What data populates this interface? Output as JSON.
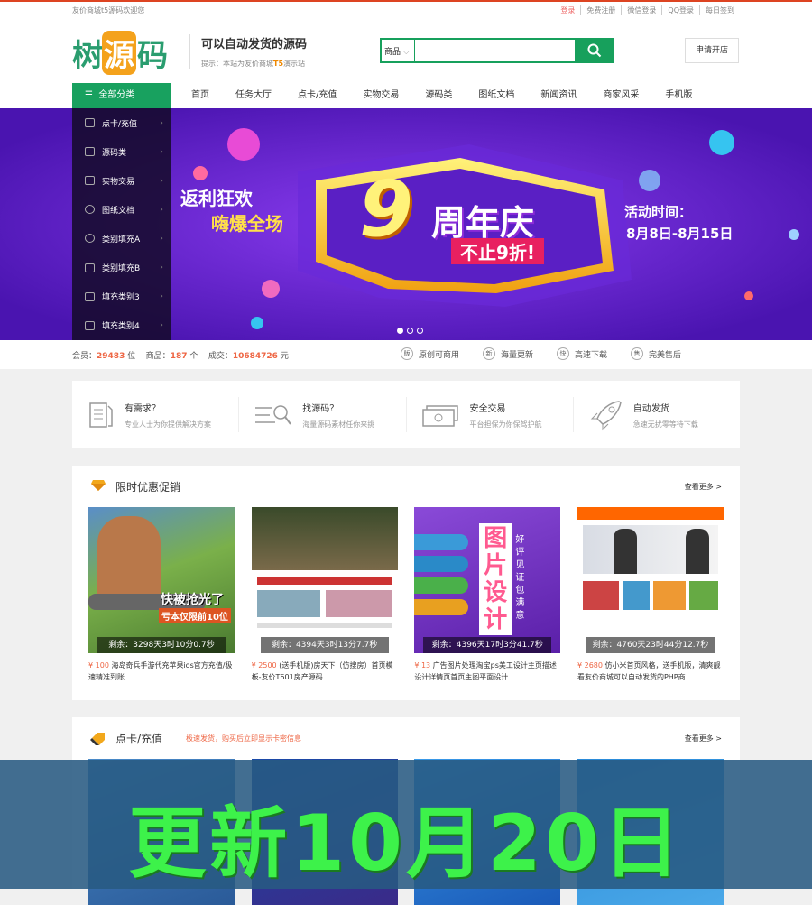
{
  "topbar": {
    "welcome": "友价商城t5源码欢迎您",
    "links": [
      "登录",
      "免费注册",
      "微信登录",
      "QQ登录",
      "每日签到"
    ]
  },
  "logo": {
    "part1": "树",
    "part2": "源",
    "part3": "码"
  },
  "slogan": {
    "title": "可以自动发货的源码",
    "tip_prefix": "提示：本站为友价商城",
    "tip_bold": "T5",
    "tip_suffix": "演示站"
  },
  "search": {
    "category": "商品",
    "placeholder": "",
    "button_icon": "search-icon"
  },
  "open_shop": "申请开店",
  "nav": {
    "all_label": "全部分类",
    "items": [
      "首页",
      "任务大厅",
      "点卡/充值",
      "实物交易",
      "源码类",
      "图纸文档",
      "新闻资讯",
      "商家风采",
      "手机版"
    ]
  },
  "side_menu": [
    "点卡/充值",
    "源码类",
    "实物交易",
    "图纸文档",
    "类别填充A",
    "类别填充B",
    "填充类别3",
    "填充类别4"
  ],
  "banner": {
    "left1": "返利狂欢",
    "left2": "嗨爆全场",
    "big_num": "9",
    "main": "周年庆",
    "sub": "不止9折!",
    "time_label": "活动时间：",
    "time_range": "8月8日-8月15日"
  },
  "stats": {
    "member_label": "会员：",
    "member_count": "29483",
    "member_unit": "位",
    "goods_label": "商品：",
    "goods_count": "187",
    "goods_unit": "个",
    "deal_label": "成交：",
    "deal_amount": "10684726",
    "deal_unit": "元",
    "badges": [
      {
        "icon": "版",
        "text": "原创可商用"
      },
      {
        "icon": "新",
        "text": "海量更新"
      },
      {
        "icon": "快",
        "text": "高速下载"
      },
      {
        "icon": "售",
        "text": "完美售后"
      }
    ]
  },
  "features": [
    {
      "title": "有需求？",
      "desc": "专业人士为你提供解决方案"
    },
    {
      "title": "找源码？",
      "desc": "海量源码素材任你来挑"
    },
    {
      "title": "安全交易",
      "desc": "平台担保为你保驾护航"
    },
    {
      "title": "自动发货",
      "desc": "急速无扰零等待下载"
    }
  ],
  "promo": {
    "title": "限时优惠促销",
    "more": "查看更多 >",
    "cards": [
      {
        "countdown": "剩余：3298天3时10分0.7秒",
        "price": "¥ 100",
        "desc": "海岛奇兵手游代充苹果ios官方充值/极速精准到账",
        "img_text1": "快被抢光了",
        "img_text2": "亏本仅限前10位"
      },
      {
        "countdown": "剩余：4394天3时13分7.7秒",
        "price": "¥ 2500",
        "desc": "(送手机版)房天下（仿搜房）首页模板-友价T601房产源码",
        "img_text1": "",
        "img_text2": ""
      },
      {
        "countdown": "剩余：4396天17时3分41.7秒",
        "price": "¥ 13",
        "desc": "广告图片处理淘宝ps美工设计主页描述设计详情页首页主图平面设计",
        "img_text1": "图片设计",
        "img_text2": "好评见证 包满意"
      },
      {
        "countdown": "剩余：4760天23时44分12.7秒",
        "price": "¥ 2680",
        "desc": "仿小米首页风格，送手机版，清爽靓看友价商城可以自动发货的PHP商",
        "img_text1": "",
        "img_text2": ""
      }
    ]
  },
  "card_section": {
    "title": "点卡/充值",
    "subtitle": "极速发货，购买后立即显示卡密信息",
    "more": "查看更多 >"
  },
  "overlay_text": "更新10月20日",
  "colors": {
    "brand_green": "#18a15f",
    "accent_orange": "#e64",
    "banner_purple": "#5a1fc4",
    "overlay_text": "#3df24a"
  }
}
